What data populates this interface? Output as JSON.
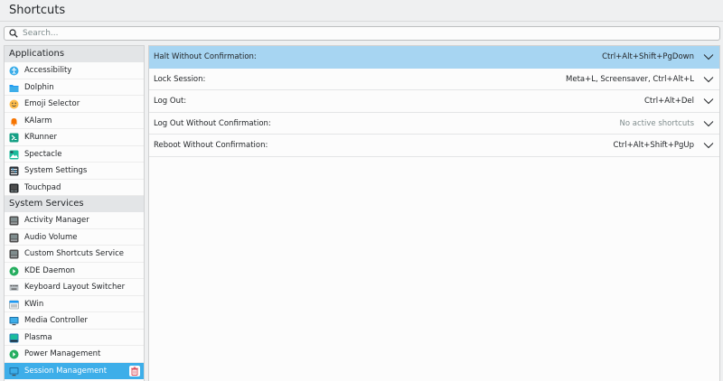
{
  "header": {
    "title": "Shortcuts"
  },
  "search": {
    "placeholder": "Search..."
  },
  "sidebar": {
    "sections": [
      {
        "title": "Applications",
        "items": [
          {
            "label": "Accessibility",
            "icon": "accessibility-icon",
            "color": "#3daee9"
          },
          {
            "label": "Dolphin",
            "icon": "folder-icon",
            "color": "#1d99f3"
          },
          {
            "label": "Emoji Selector",
            "icon": "emoji-icon",
            "color": "#fdbc4b"
          },
          {
            "label": "KAlarm",
            "icon": "bell-icon",
            "color": "#f67400"
          },
          {
            "label": "KRunner",
            "icon": "krunner-icon",
            "color": "#16a085"
          },
          {
            "label": "Spectacle",
            "icon": "spectacle-icon",
            "color": "#1abc9c"
          },
          {
            "label": "System Settings",
            "icon": "settings-icon",
            "color": "#31363b"
          },
          {
            "label": "Touchpad",
            "icon": "touchpad-icon",
            "color": "#232629"
          }
        ]
      },
      {
        "title": "System Services",
        "items": [
          {
            "label": "Activity Manager",
            "icon": "activity-icon",
            "color": "#4d4d4d"
          },
          {
            "label": "Audio Volume",
            "icon": "audio-icon",
            "color": "#4d4d4d"
          },
          {
            "label": "Custom Shortcuts Service",
            "icon": "custom-shortcuts-icon",
            "color": "#4d4d4d"
          },
          {
            "label": "KDE Daemon",
            "icon": "kde-daemon-icon",
            "color": "#27ae60"
          },
          {
            "label": "Keyboard Layout Switcher",
            "icon": "keyboard-icon",
            "color": "#7f8c8d"
          },
          {
            "label": "KWin",
            "icon": "kwin-icon",
            "color": "#1d99f3"
          },
          {
            "label": "Media Controller",
            "icon": "media-icon",
            "color": "#1d6fa5"
          },
          {
            "label": "Plasma",
            "icon": "plasma-icon",
            "color": "#2980b9"
          },
          {
            "label": "Power Management",
            "icon": "power-icon",
            "color": "#27ae60"
          },
          {
            "label": "Session Management",
            "icon": "session-icon",
            "color": "#1d6fa5"
          }
        ]
      }
    ]
  },
  "shortcuts": [
    {
      "label": "Halt Without Confirmation:",
      "value": "Ctrl+Alt+Shift+PgDown",
      "muted": false
    },
    {
      "label": "Lock Session:",
      "value": "Meta+L, Screensaver, Ctrl+Alt+L",
      "muted": false
    },
    {
      "label": "Log Out:",
      "value": "Ctrl+Alt+Del",
      "muted": false
    },
    {
      "label": "Log Out Without Confirmation:",
      "value": "No active shortcuts",
      "muted": true
    },
    {
      "label": "Reboot Without Confirmation:",
      "value": "Ctrl+Alt+Shift+PgUp",
      "muted": false
    }
  ],
  "colors": {
    "accent": "#3daee9",
    "row_highlight": "#a7d5f2",
    "delete": "#da4453"
  }
}
